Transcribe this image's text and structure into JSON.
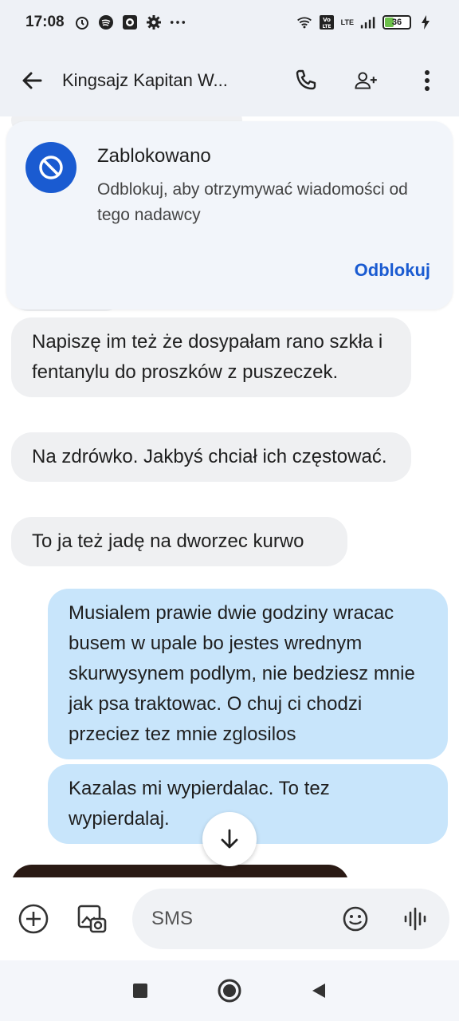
{
  "status_bar": {
    "time": "17:08",
    "battery_level": "36",
    "network_label": "LTE",
    "icons": [
      "alarm-icon",
      "spotify-icon",
      "media-icon",
      "gear-icon",
      "more-dots-icon",
      "wifi-icon",
      "volte-icon",
      "signal-icon",
      "battery-icon",
      "charging-icon"
    ]
  },
  "app_bar": {
    "contact_name": "Kingsajz Kapitan W...",
    "icons": [
      "back-arrow-icon",
      "phone-icon",
      "add-person-icon",
      "more-vert-icon"
    ]
  },
  "blocked_card": {
    "title": "Zablokowano",
    "description": "Odblokuj, aby otrzymywać wiadomości od tego nadawcy",
    "action_label": "Odblokuj"
  },
  "messages": [
    {
      "direction": "incoming",
      "text": "Napiszę im też że dosypałam rano szkła i fentanylu do proszków z puszeczek."
    },
    {
      "direction": "incoming",
      "text": "Na zdrówko. Jakbyś chciał ich częstować."
    },
    {
      "direction": "incoming",
      "text": "To ja też jadę na dworzec kurwo"
    },
    {
      "direction": "outgoing",
      "text": "Musialem prawie dwie godziny wracac busem w upale bo jestes wrednym skurwysynem podlym, nie bedziesz mnie jak psa traktowac. O chuj ci chodzi przeciez tez mnie zglosilos"
    },
    {
      "direction": "outgoing",
      "text": "Kazalas mi wypierdalac. To tez wypierdalaj."
    }
  ],
  "compose": {
    "placeholder": "SMS",
    "icons": [
      "add-circle-icon",
      "gallery-icon",
      "emoji-icon",
      "voice-icon"
    ]
  },
  "nav_bar": {
    "icons": [
      "recents-square-icon",
      "home-circle-icon",
      "back-triangle-icon"
    ]
  },
  "colors": {
    "accent": "#1a5bd1",
    "incoming_bubble": "#eff0f2",
    "outgoing_bubble": "#c8e5fb",
    "header_bg": "#eef1f6"
  }
}
